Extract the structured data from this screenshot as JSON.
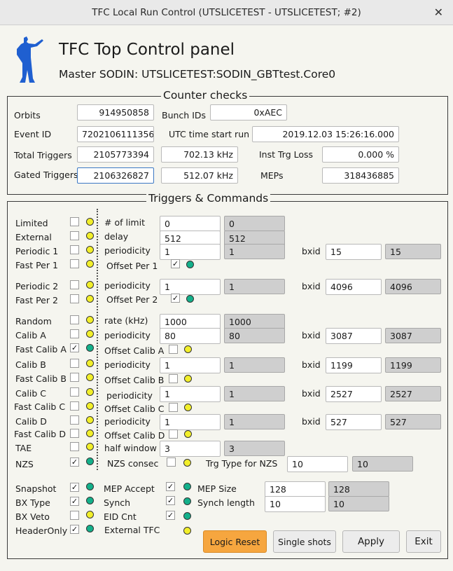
{
  "window": {
    "title": "TFC Local Run Control (UTSLICETEST - UTSLICETEST; #2)",
    "close": "✕"
  },
  "header": {
    "title": "TFC Top Control panel",
    "subtitle": "Master SODIN: UTSLICETEST:SODIN_GBTtest.Core0"
  },
  "counters": {
    "title": "Counter checks",
    "orbits_label": "Orbits",
    "orbits": "914950858",
    "bunch_label": "Bunch IDs",
    "bunch": "0xAEC",
    "event_label": "Event ID",
    "event": "7202106111356",
    "utc_label": "UTC time start run",
    "utc": "2019.12.03 15:26:16.000",
    "total_label": "Total Triggers",
    "total": "2105773394",
    "total_rate": "702.13 kHz",
    "inst_label": "Inst Trg Loss",
    "inst": "0.000 %",
    "gated_label": "Gated Triggers",
    "gated": "2106326827",
    "gated_rate": "512.07 kHz",
    "meps_label": "MEPs",
    "meps": "318436885"
  },
  "triggers": {
    "title": "Triggers & Commands",
    "limited": "Limited",
    "limit_label": "# of limit",
    "limit_in": "0",
    "limit_ro": "0",
    "external": "External",
    "delay_label": "delay",
    "delay_in": "512",
    "delay_ro": "512",
    "periodic1": "Periodic 1",
    "p1_label": "periodicity",
    "p1_in": "1",
    "p1_ro": "1",
    "bxid": "bxid",
    "p1_bx_in": "15",
    "p1_bx_ro": "15",
    "fastper1": "Fast Per 1",
    "offper1": "Offset Per 1",
    "periodic2": "Periodic 2",
    "p2_label": "periodicity",
    "p2_in": "1",
    "p2_ro": "1",
    "p2_bx_in": "4096",
    "p2_bx_ro": "4096",
    "fastper2": "Fast Per 2",
    "offper2": "Offset Per 2",
    "random": "Random",
    "rate_label": "rate (kHz)",
    "rate_in": "1000",
    "rate_ro": "1000",
    "calibA": "Calib A",
    "cA_label": "periodicity",
    "cA_in": "80",
    "cA_ro": "80",
    "cA_bx_in": "3087",
    "cA_bx_ro": "3087",
    "fastcalibA": "Fast Calib A",
    "offcalibA": "Offset Calib A",
    "calibB": "Calib B",
    "cB_label": "periodicity",
    "cB_in": "1",
    "cB_ro": "1",
    "cB_bx_in": "1199",
    "cB_bx_ro": "1199",
    "fastcalibB": "Fast Calib B",
    "offcalibB": "Offset Calib B",
    "calibC": "Calib C",
    "cC_label": "periodicity",
    "cC_in": "1",
    "cC_ro": "1",
    "cC_bx_in": "2527",
    "cC_bx_ro": "2527",
    "fastcalibC": "Fast Calib C",
    "offcalibC": "Offset Calib C",
    "calibD": "Calib D",
    "cD_label": "periodicity",
    "cD_in": "1",
    "cD_ro": "1",
    "cD_bx_in": "527",
    "cD_bx_ro": "527",
    "fastcalibD": "Fast Calib D",
    "offcalibD": "Offset Calib D",
    "tae": "TAE",
    "hw_label": "half window",
    "hw_in": "3",
    "hw_ro": "3",
    "nzs": "NZS",
    "nzsconsec": "NZS consec",
    "trgtype_label": "Trg Type for NZS",
    "trgtype_in": "10",
    "trgtype_ro": "10",
    "snapshot": "Snapshot",
    "mepaccept": "MEP Accept",
    "mepsize_label": "MEP Size",
    "mepsize_in": "128",
    "mepsize_ro": "128",
    "bxtype": "BX Type",
    "synch": "Synch",
    "synchlen_label": "Synch length",
    "synchlen_in": "10",
    "synchlen_ro": "10",
    "bxveto": "BX Veto",
    "eidcnt": "EID Cnt",
    "headeronly": "HeaderOnly",
    "externaltfc": "External TFC",
    "check": "✓"
  },
  "buttons": {
    "logic_reset": "Logic Reset",
    "single_shots": "Single shots",
    "apply": "Apply",
    "exit": "Exit"
  },
  "colors": {
    "led_yellow": "#f2ef2a",
    "led_green": "#13b08a",
    "logic_reset_bg": "#f6a63f",
    "panel_bg": "#f5f5ef"
  },
  "icons": {
    "logo": "conductor-silhouette-icon",
    "close": "close-icon"
  }
}
